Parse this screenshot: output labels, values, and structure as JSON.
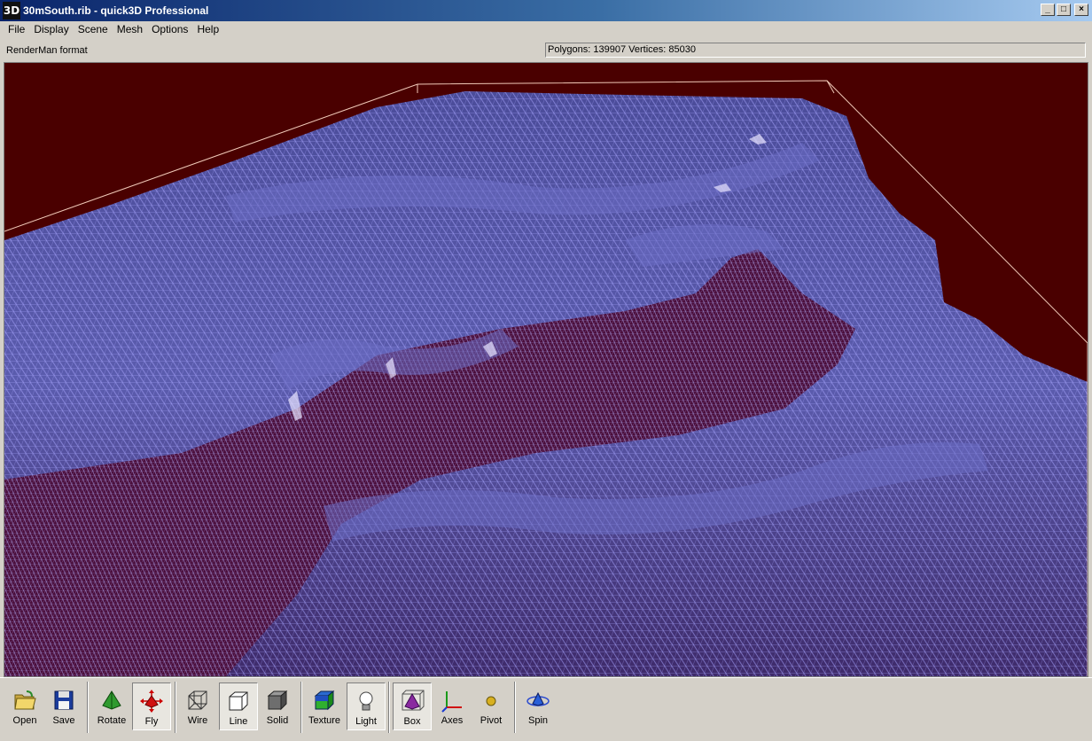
{
  "window": {
    "icon_text": "3D",
    "title": "30mSouth.rib - quick3D Professional",
    "minimize": "_",
    "maximize": "□",
    "close": "×"
  },
  "menu": [
    {
      "label": "File"
    },
    {
      "label": "Display"
    },
    {
      "label": "Scene"
    },
    {
      "label": "Mesh"
    },
    {
      "label": "Options"
    },
    {
      "label": "Help"
    }
  ],
  "status": {
    "format": "RenderMan format",
    "stats": "Polygons: 139907  Vertices: 85030"
  },
  "viewport": {
    "background_color": "#4a0000",
    "mesh_color": "#5b5cae",
    "wire_color": "#a9a6ff",
    "box_color": "#f0c9b8"
  },
  "toolbar": {
    "items": [
      {
        "label": "Open",
        "icon": "folder-icon",
        "pressed": false
      },
      {
        "label": "Save",
        "icon": "floppy-icon",
        "pressed": false
      },
      {
        "label": "Rotate",
        "icon": "rotate-icon",
        "pressed": false
      },
      {
        "label": "Fly",
        "icon": "fly-arrows-icon",
        "pressed": true
      },
      {
        "label": "Wire",
        "icon": "wire-cube-icon",
        "pressed": false
      },
      {
        "label": "Line",
        "icon": "line-cube-icon",
        "pressed": true
      },
      {
        "label": "Solid",
        "icon": "solid-cube-icon",
        "pressed": false
      },
      {
        "label": "Texture",
        "icon": "texture-cube-icon",
        "pressed": false
      },
      {
        "label": "Light",
        "icon": "light-bulb-icon",
        "pressed": true
      },
      {
        "label": "Box",
        "icon": "box-pyramid-icon",
        "pressed": true
      },
      {
        "label": "Axes",
        "icon": "axes-icon",
        "pressed": false
      },
      {
        "label": "Pivot",
        "icon": "pivot-icon",
        "pressed": false
      },
      {
        "label": "Spin",
        "icon": "spin-icon",
        "pressed": false
      }
    ]
  }
}
